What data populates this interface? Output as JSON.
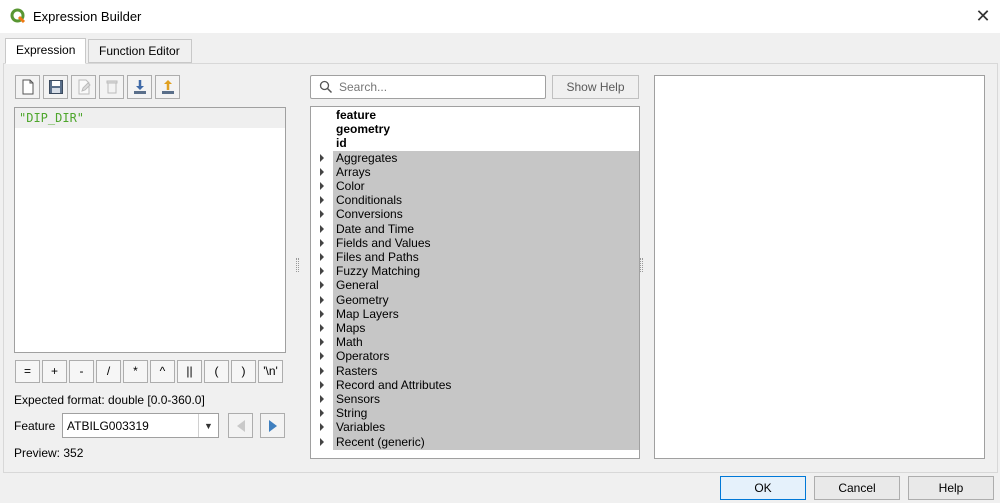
{
  "window": {
    "title": "Expression Builder",
    "close_glyph": "✕"
  },
  "tabs": [
    {
      "label": "Expression",
      "active": true
    },
    {
      "label": "Function Editor",
      "active": false
    }
  ],
  "toolbar": {
    "icons": [
      "new-file-icon",
      "save-icon",
      "edit-icon",
      "delete-icon",
      "import-icon",
      "export-icon"
    ]
  },
  "editor": {
    "expression": "\"DIP_DIR\""
  },
  "operators": [
    "=",
    "+",
    "-",
    "/",
    "*",
    "^",
    "||",
    "(",
    ")",
    "'\\n'"
  ],
  "expected_format": "Expected format:  double [0.0-360.0]",
  "feature": {
    "label": "Feature",
    "value": "ATBILG003319"
  },
  "preview": "Preview:   352",
  "search": {
    "placeholder": "Search..."
  },
  "show_help_label": "Show Help",
  "tree": {
    "top_items": [
      "feature",
      "geometry",
      "id"
    ],
    "groups": [
      "Aggregates",
      "Arrays",
      "Color",
      "Conditionals",
      "Conversions",
      "Date and Time",
      "Fields and Values",
      "Files and Paths",
      "Fuzzy Matching",
      "General",
      "Geometry",
      "Map Layers",
      "Maps",
      "Math",
      "Operators",
      "Rasters",
      "Record and Attributes",
      "Sensors",
      "String",
      "Variables",
      "Recent (generic)"
    ]
  },
  "buttons": {
    "ok": "OK",
    "cancel": "Cancel",
    "help": "Help"
  },
  "colors": {
    "expression_text": "#4ea62c",
    "group_bg": "#c6c6c6",
    "ok_border": "#0078d7"
  }
}
